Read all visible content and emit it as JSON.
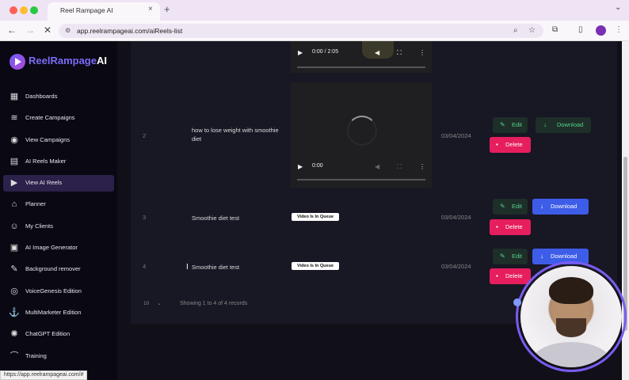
{
  "browser": {
    "tab_title": "Reel Rampage AI",
    "url": "app.reelrampageai.com/aiReels-list",
    "status_url": "https://app.reelrampageai.com/#",
    "close_glyph": "×",
    "new_tab_glyph": "+"
  },
  "app": {
    "logo_main": "ReelRampage",
    "logo_ai": "AI"
  },
  "sidebar": {
    "items": [
      {
        "label": "Dashboards",
        "icon": "grid-icon"
      },
      {
        "label": "Create Campaigns",
        "icon": "layers-icon"
      },
      {
        "label": "View Campaigns",
        "icon": "eye-icon"
      },
      {
        "label": "AI Reels Maker",
        "icon": "film-icon"
      },
      {
        "label": "View AI Reels",
        "icon": "play-square-icon",
        "active": true
      },
      {
        "label": "Planner",
        "icon": "bank-icon"
      },
      {
        "label": "My Clients",
        "icon": "users-icon"
      },
      {
        "label": "AI Image Generator",
        "icon": "image-icon"
      },
      {
        "label": "Background remover",
        "icon": "brush-icon"
      },
      {
        "label": "VoiceGenesis Edition",
        "icon": "voice-icon"
      },
      {
        "label": "MultiMarketer Edition",
        "icon": "anchor-icon"
      },
      {
        "label": "ChatGPT Edition",
        "icon": "openai-icon"
      },
      {
        "label": "Training",
        "icon": "cap-icon"
      }
    ]
  },
  "video_top": {
    "time": "0:00 / 2:05"
  },
  "video_mid": {
    "time": "0:00"
  },
  "rows": [
    {
      "num": "2",
      "title": "how to lose weight with smoothie diet",
      "date": "03/04/2024",
      "edit": "Edit",
      "download": "Download",
      "delete": "Delete"
    },
    {
      "num": "3",
      "title": "Smoothie diet test",
      "status": "Video Is In Queue",
      "date": "03/04/2024",
      "edit": "Edit",
      "download": "Download",
      "delete": "Delete"
    },
    {
      "num": "4",
      "title": "Smoothie diet test",
      "status": "Video Is In Queue",
      "date": "03/04/2024",
      "edit": "Edit",
      "download": "Download",
      "delete": "Delete"
    }
  ],
  "pager": {
    "page_size": "10",
    "info": "Showing 1 to 4 of 4 records"
  },
  "colors": {
    "accent": "#7b6cf6",
    "download_blue": "#3d5ce8",
    "delete_red": "#e61e5e",
    "edit_green": "#57d38c"
  }
}
